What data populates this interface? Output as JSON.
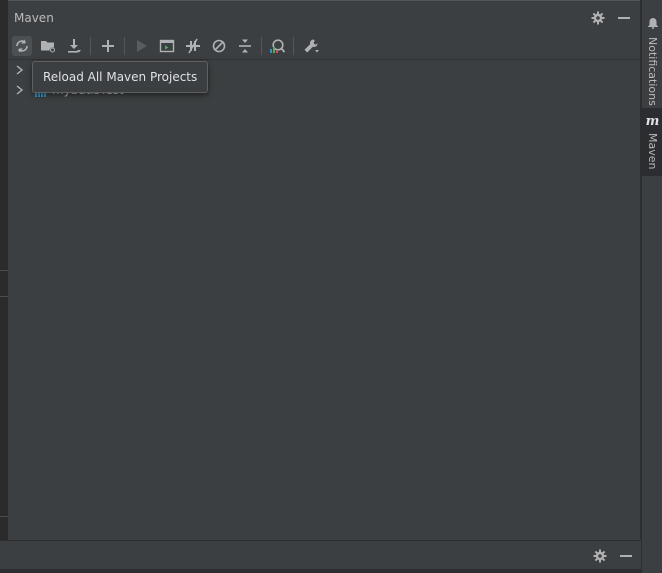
{
  "window": {
    "title": "Maven"
  },
  "tooltip": {
    "text": "Reload All Maven Projects"
  },
  "tree": {
    "items": [
      {
        "label": ""
      },
      {
        "label": "mybatisTest"
      }
    ]
  },
  "stripe": {
    "notifications_label": "Notifications",
    "maven_label": "Maven",
    "maven_icon_glyph": "m"
  },
  "toolbar": {
    "icons": [
      "reload-icon",
      "add-source-folder-icon",
      "download-icon",
      "add-icon",
      "run-icon",
      "execute-goal-icon",
      "toggle-offline-icon",
      "skip-tests-icon",
      "collapse-all-icon",
      "analyze-dependencies-icon",
      "settings-wrench-icon"
    ]
  },
  "colors": {
    "background": "#3c3f41",
    "text": "#bbbbbb",
    "accent_blue": "#3592c4",
    "run_green": "#59a869"
  }
}
